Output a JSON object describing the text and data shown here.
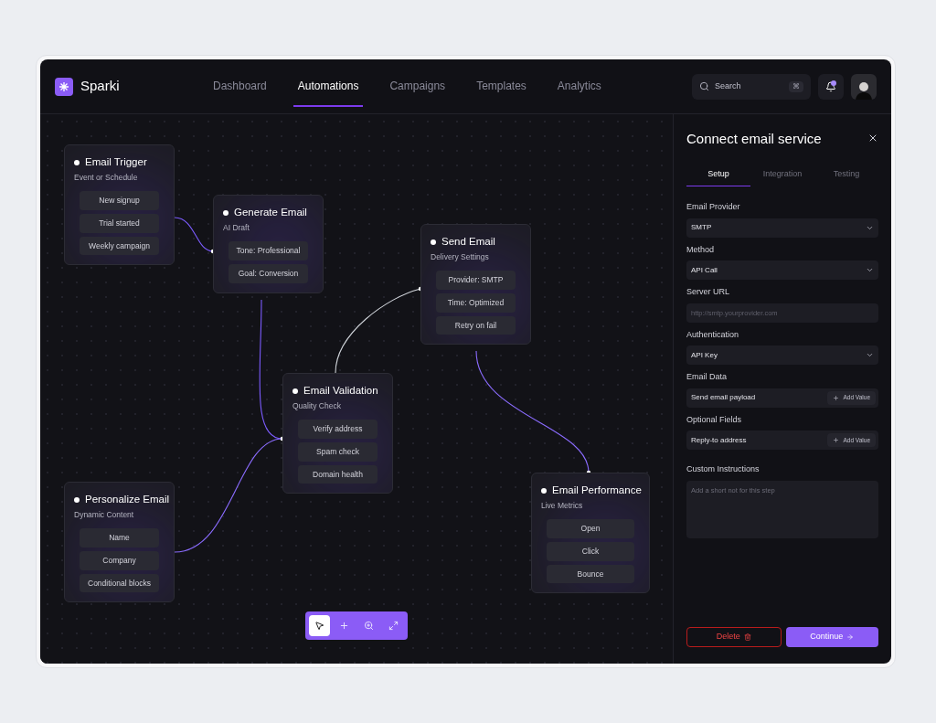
{
  "brand": {
    "name": "Sparki"
  },
  "nav": [
    {
      "label": "Dashboard",
      "selected": false
    },
    {
      "label": "Automations",
      "selected": true
    },
    {
      "label": "Campaigns",
      "selected": false
    },
    {
      "label": "Templates",
      "selected": false
    },
    {
      "label": "Analytics",
      "selected": false
    }
  ],
  "search": {
    "placeholder": "Search",
    "shortcut": "⌘"
  },
  "notifications": {
    "unread": true
  },
  "nodes": [
    {
      "title": "Email Trigger",
      "subtitle": "Event or Schedule",
      "items": [
        "New signup",
        "Trial started",
        "Weekly campaign"
      ]
    },
    {
      "title": "Generate Email",
      "subtitle": "AI Draft",
      "items": [
        "Tone: Professional",
        "Goal: Conversion"
      ]
    },
    {
      "title": "Send Email",
      "subtitle": "Delivery Settings",
      "items": [
        "Provider: SMTP",
        "Time: Optimized",
        "Retry on fail"
      ]
    },
    {
      "title": "Email Validation",
      "subtitle": "Quality Check",
      "items": [
        "Verify address",
        "Spam check",
        "Domain health"
      ]
    },
    {
      "title": "Personalize Email",
      "subtitle": "Dynamic Content",
      "items": [
        "Name",
        "Company",
        "Conditional blocks"
      ]
    },
    {
      "title": "Email Performance",
      "subtitle": "Live Metrics",
      "items": [
        "Open",
        "Click",
        "Bounce"
      ]
    }
  ],
  "toolbar": [
    {
      "kind": "select",
      "selected": true
    },
    {
      "kind": "add",
      "selected": false
    },
    {
      "kind": "zoom",
      "selected": false
    },
    {
      "kind": "fit",
      "selected": false
    }
  ],
  "panel": {
    "title": "Connect email service",
    "tabs": [
      {
        "label": "Setup",
        "selected": true
      },
      {
        "label": "Integration",
        "selected": false
      },
      {
        "label": "Testing",
        "selected": false
      }
    ],
    "fields": [
      {
        "kind": "select",
        "label": "Email Provider",
        "value": "SMTP"
      },
      {
        "kind": "select",
        "label": "Method",
        "value": "API Call"
      },
      {
        "kind": "input",
        "label": "Server URL",
        "placeholder": "http://smtp.yourprovider.com"
      },
      {
        "kind": "select",
        "label": "Authentication",
        "value": "API Key"
      },
      {
        "kind": "addvalue",
        "label": "Email Data",
        "value": "Send email payload",
        "action": "Add Value"
      },
      {
        "kind": "addvalue",
        "label": "Optional Fields",
        "value": "Reply-to address",
        "action": "Add Value"
      },
      {
        "kind": "textarea",
        "label": "Custom Instructions",
        "placeholder": "Add a short not for this step"
      }
    ],
    "delete": "Delete",
    "continue": "Continue"
  }
}
